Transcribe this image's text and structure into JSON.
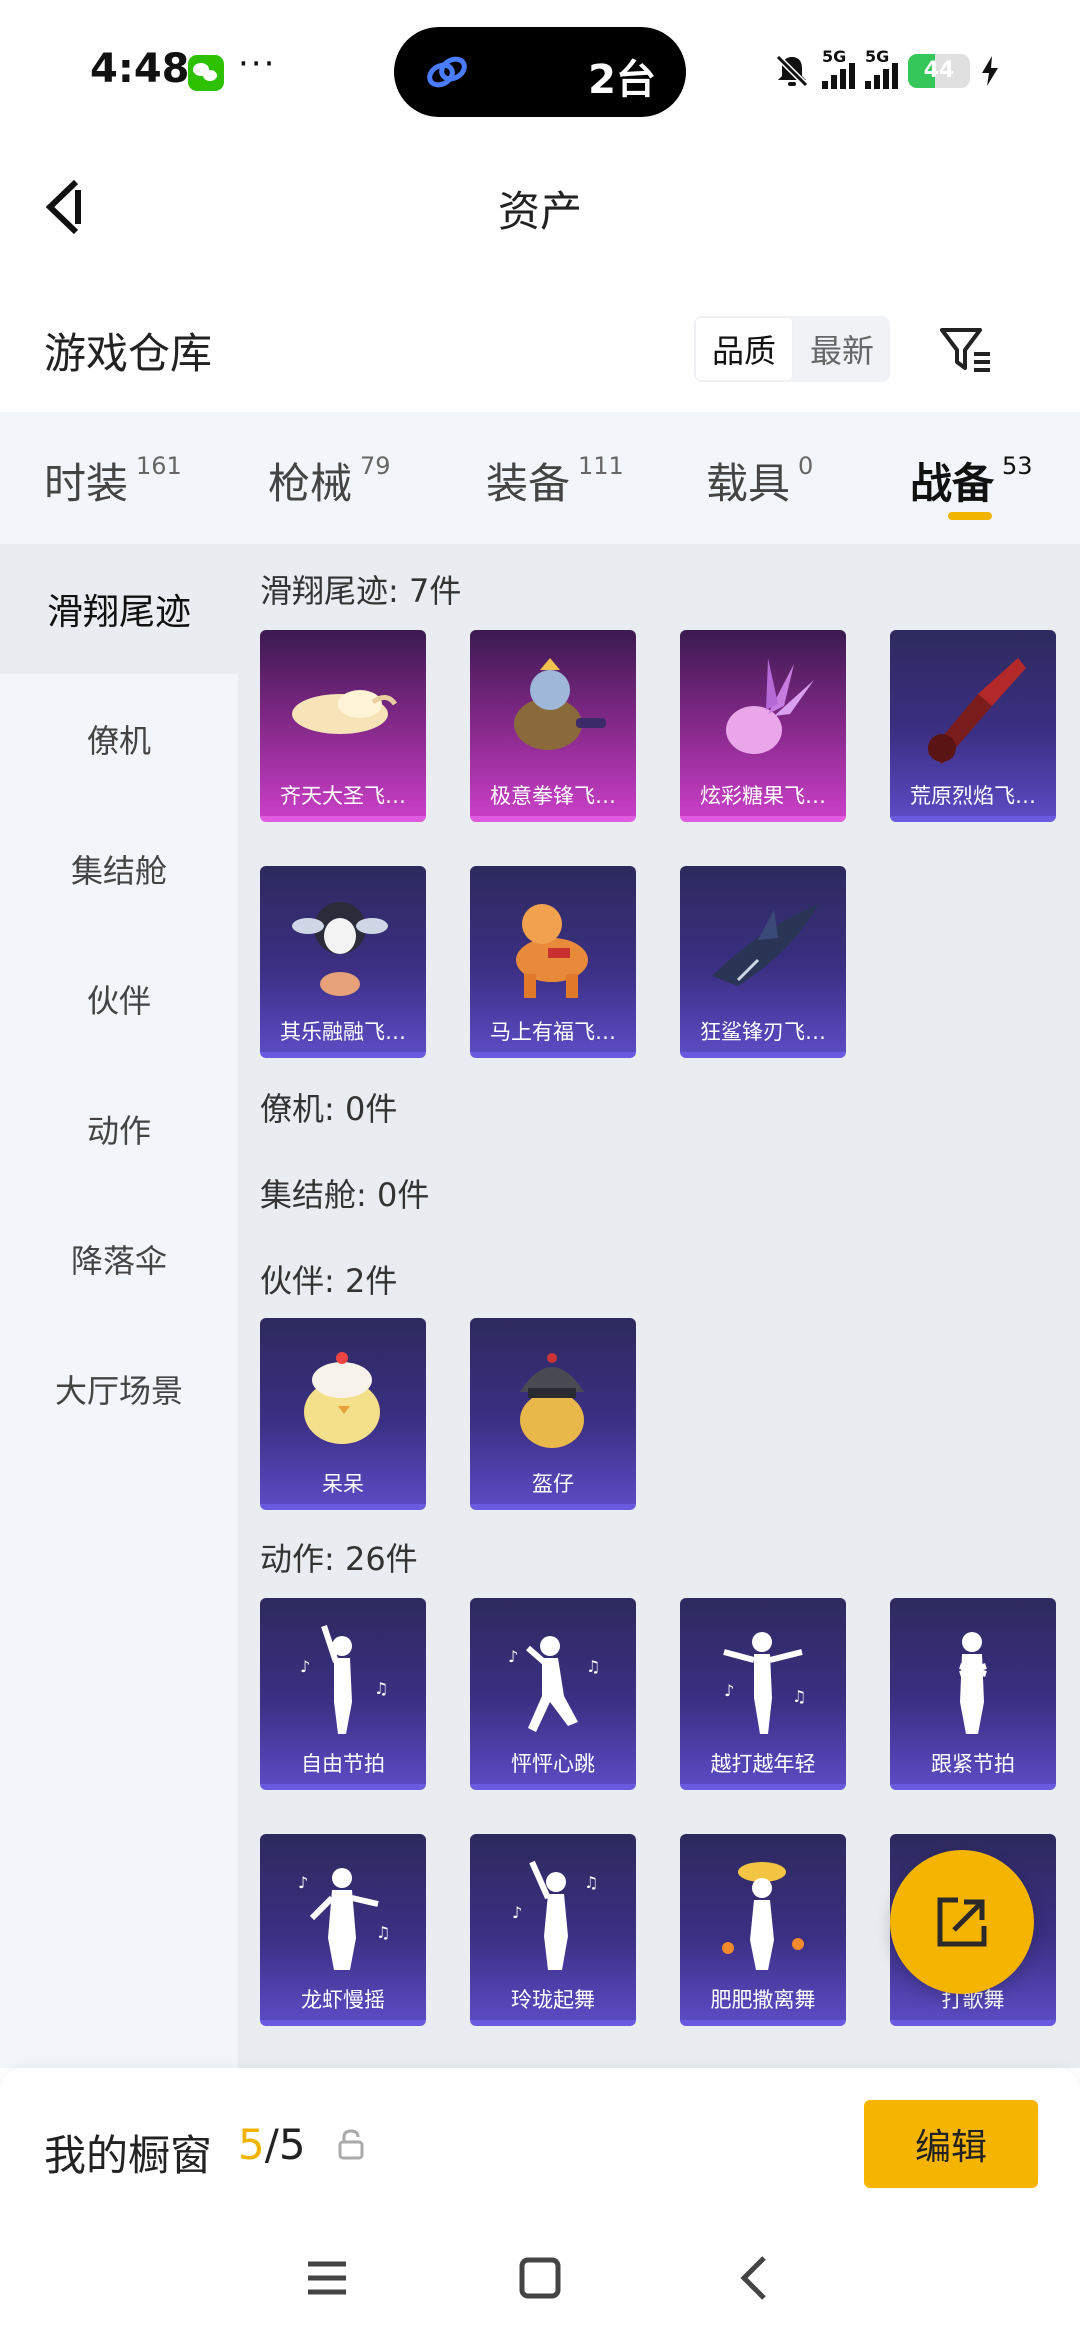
{
  "status_bar": {
    "time": "4:48",
    "more": "···",
    "island_count": "2台",
    "signal1_label": "5G",
    "signal2_label": "5G",
    "battery": "44"
  },
  "header": {
    "title": "资产"
  },
  "section": {
    "title": "游戏仓库",
    "sort_options": [
      "品质",
      "最新"
    ]
  },
  "tabs": [
    {
      "label": "时装",
      "count": "161"
    },
    {
      "label": "枪械",
      "count": "79"
    },
    {
      "label": "装备",
      "count": "111"
    },
    {
      "label": "载具",
      "count": "0"
    },
    {
      "label": "战备",
      "count": "53"
    }
  ],
  "sidebar": {
    "items": [
      "滑翔尾迹",
      "僚机",
      "集结舱",
      "伙伴",
      "动作",
      "降落伞",
      "大厅场景"
    ]
  },
  "groups": {
    "glide_label": "滑翔尾迹: 7件",
    "glide_items": [
      "齐天大圣飞…",
      "极意拳锋飞…",
      "炫彩糖果飞…",
      "荒原烈焰飞…",
      "其乐融融飞…",
      "马上有福飞…",
      "狂鲨锋刃飞…"
    ],
    "wingman_label": "僚机: 0件",
    "pod_label": "集结舱: 0件",
    "partner_label": "伙伴: 2件",
    "partner_items": [
      "呆呆",
      "盔仔"
    ],
    "emote_label": "动作: 26件",
    "emote_items": [
      "自由节拍",
      "怦怦心跳",
      "越打越年轻",
      "跟紧节拍",
      "龙虾慢摇",
      "玲珑起舞",
      "肥肥撒离舞",
      "打歌舞"
    ]
  },
  "showcase": {
    "title": "我的橱窗",
    "current": "5",
    "separator_total": "/5",
    "edit_label": "编辑"
  },
  "colors": {
    "accent": "#f5b400",
    "card_purple": "#3b2f83",
    "card_pink": "#c83fc6",
    "sidebar_bg": "#f2f5f9"
  }
}
